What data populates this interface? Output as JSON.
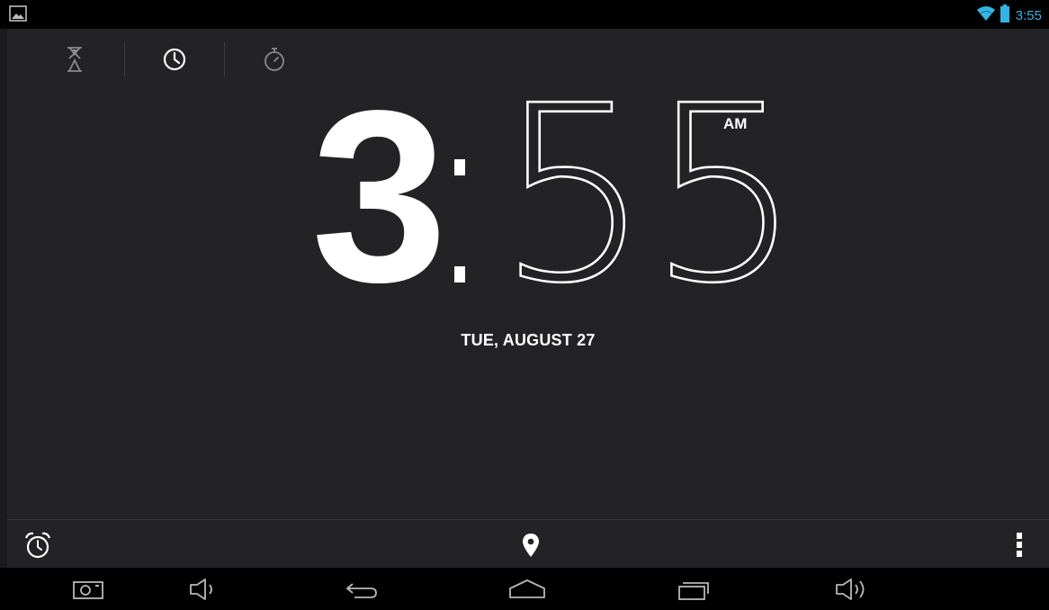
{
  "status_bar": {
    "time": "3:55",
    "icons": [
      "gallery-icon",
      "wifi-icon",
      "battery-icon"
    ],
    "accent_color": "#33b5e5"
  },
  "tabs": [
    {
      "name": "timer",
      "icon": "hourglass-icon",
      "selected": false
    },
    {
      "name": "clock",
      "icon": "clock-icon",
      "selected": true
    },
    {
      "name": "stopwatch",
      "icon": "stopwatch-icon",
      "selected": false
    }
  ],
  "clock": {
    "hour": "3",
    "separator": ":",
    "minutes": "55",
    "ampm": "AM",
    "date": "TUE, AUGUST 27"
  },
  "bottom_bar": {
    "icons": [
      "alarm-icon",
      "location-pin-icon",
      "overflow-menu-icon"
    ]
  },
  "nav_bar": {
    "icons": [
      "screenshot-icon",
      "volume-down-icon",
      "back-icon",
      "home-icon",
      "recent-apps-icon",
      "volume-up-icon"
    ]
  },
  "colors": {
    "background": "#232325",
    "bars": "#000000",
    "text": "#ffffff"
  }
}
